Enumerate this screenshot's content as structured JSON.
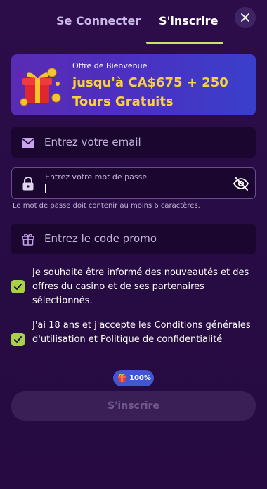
{
  "tabs": {
    "login_label": "Se Connecter",
    "signup_label": "S'inscrire",
    "active": "signup"
  },
  "close": {
    "icon": "close-icon"
  },
  "banner": {
    "label": "Offre de Bienvenue",
    "title": "jusqu'à CA$675 + 250 Tours Gratuits",
    "icon": "gift-box-icon",
    "title_color": "#f7d23b"
  },
  "form": {
    "email": {
      "placeholder": "Entrez votre email",
      "icon": "envelope-icon"
    },
    "password": {
      "label": "Entrez votre mot de passe",
      "value": "",
      "icon": "lock-icon",
      "toggle_icon": "eye-off-icon",
      "hint": "Le mot de passe doit contenir au moins 6 caractères."
    },
    "promo": {
      "placeholder": "Entrez le code promo",
      "icon": "gift-icon"
    }
  },
  "checkboxes": [
    {
      "checked": true,
      "text": "Je souhaite être informé des nouveautés et des offres du casino et de ses partenaires sélectionnés."
    },
    {
      "checked": true,
      "text_before": "J'ai 18 ans et j'accepte les ",
      "link1": "Conditions générales d'utilisation",
      "text_middle": " et ",
      "link2": "Politique de confidentialité"
    }
  ],
  "progress": {
    "percent_label": "100%",
    "value": 1.0,
    "icon": "gift-small-icon"
  },
  "submit": {
    "label": "S'inscrire",
    "enabled": false
  },
  "colors": {
    "background": "#2a0c47",
    "accent_green": "#a6d24a",
    "tab_underline": "#c9e46b",
    "badge_blue": "#4257cf"
  }
}
